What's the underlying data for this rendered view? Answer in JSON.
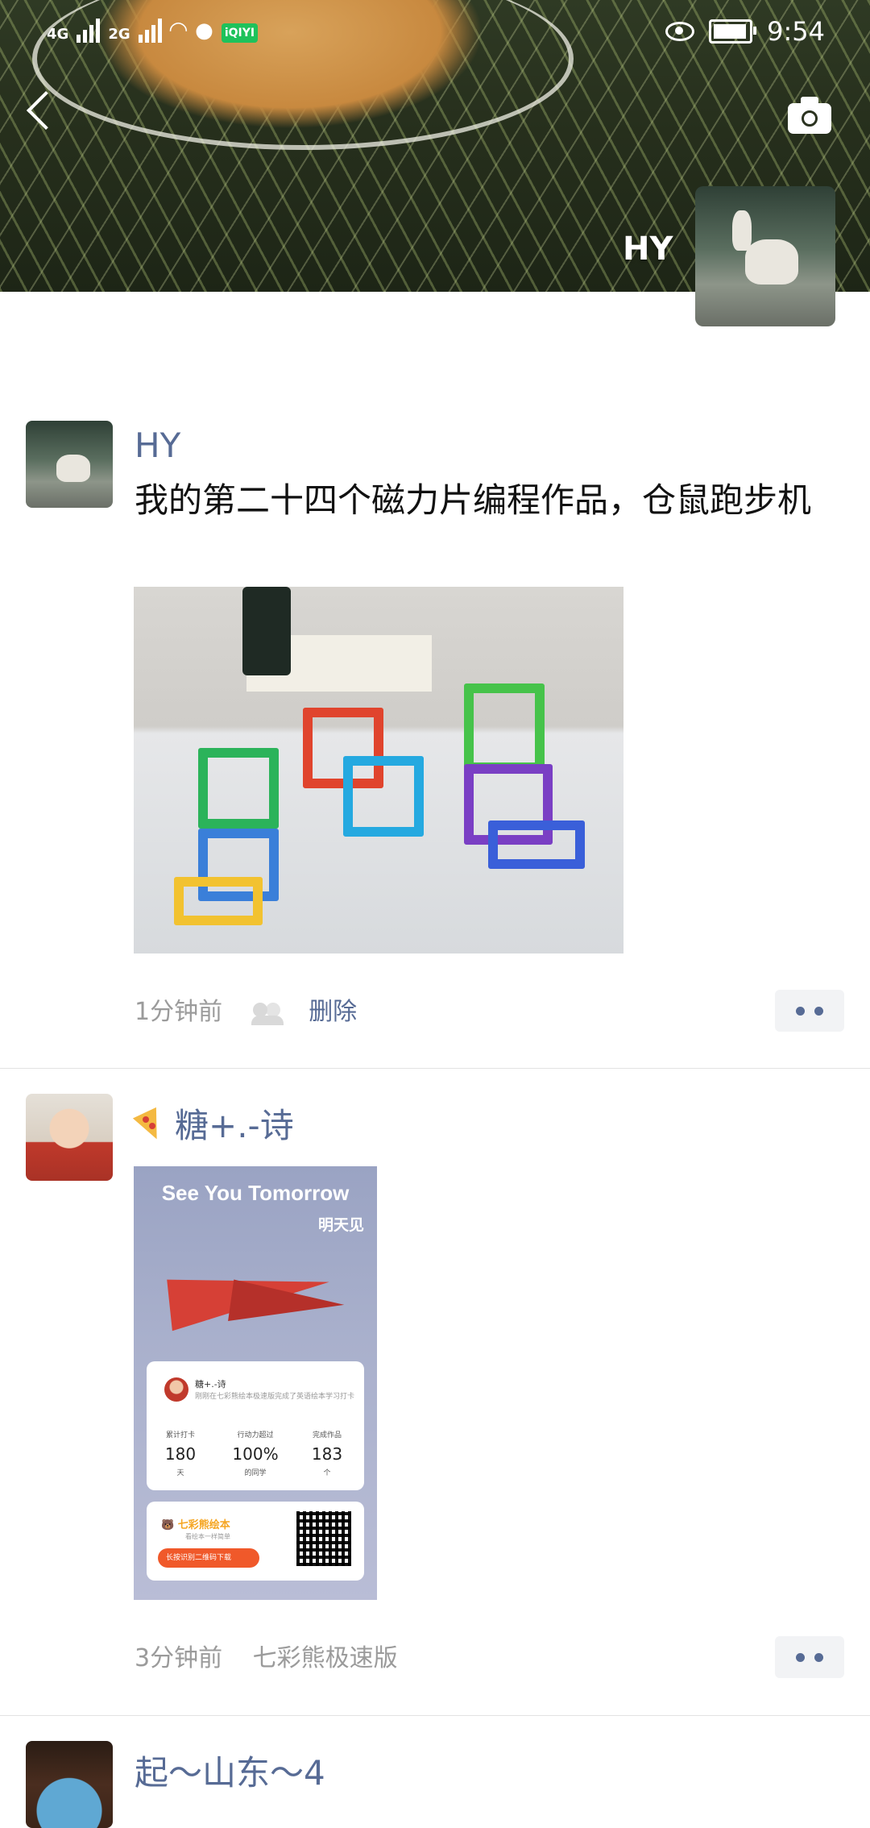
{
  "status_bar": {
    "network_1": "4G",
    "network_2": "2G",
    "app_badge": "iQIYI",
    "time": "9:54"
  },
  "cover": {
    "user_name": "HY"
  },
  "posts": [
    {
      "username": "HY",
      "text": "我的第二十四个磁力片编程作品，仓鼠跑步机",
      "time": "1分钟前",
      "delete_label": "删除"
    },
    {
      "username": "糖+.-诗",
      "poster": {
        "title": "See You Tomorrow",
        "subtitle": "明天见",
        "card_name": "糖+.-诗",
        "card_desc": "刚刚在七彩熊绘本极速版完成了英语绘本学习打卡",
        "stats": [
          {
            "label": "累计打卡",
            "value": "180",
            "unit": "天"
          },
          {
            "label": "行动力超过",
            "value": "100%",
            "unit": "的同学"
          },
          {
            "label": "完成作品",
            "value": "183",
            "unit": "个"
          }
        ],
        "brand": "七彩熊绘本",
        "brand_sub": "看绘本一样简单",
        "download_label": "长按识别二维码下载"
      },
      "time": "3分钟前",
      "source": "七彩熊极速版"
    },
    {
      "username": "起～山东～4"
    }
  ],
  "colors": {
    "link": "#576b95",
    "meta": "#9b9b9b",
    "divider": "#e2e2e2"
  }
}
